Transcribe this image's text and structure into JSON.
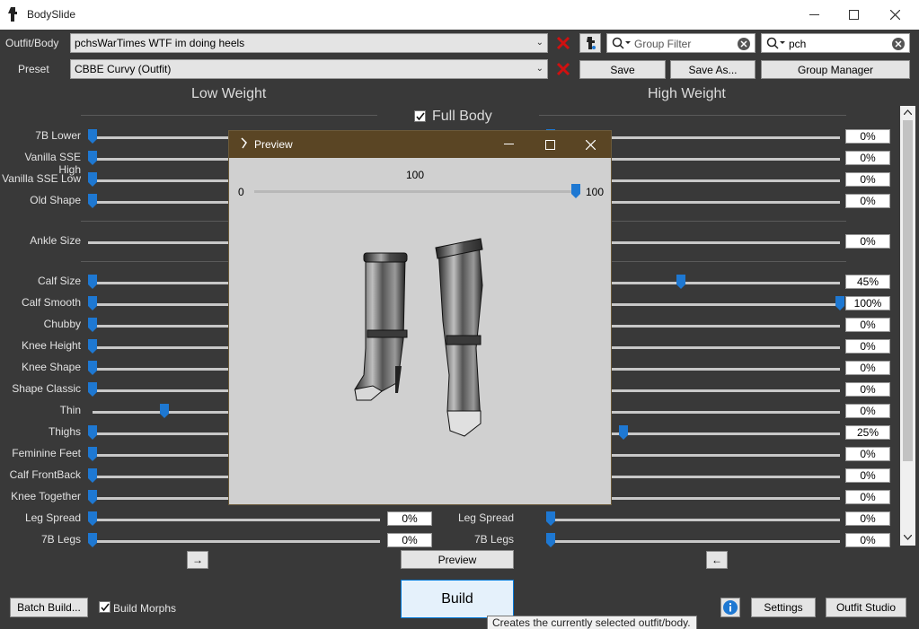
{
  "window": {
    "title": "BodySlide"
  },
  "outfit_row": {
    "label": "Outfit/Body",
    "value": "pchsWarTimes WTF im doing heels",
    "group_filter_placeholder": "Group Filter",
    "outfit_filter_value": "pch"
  },
  "preset_row": {
    "label": "Preset",
    "value": "CBBE Curvy (Outfit)",
    "save_label": "Save",
    "save_as_label": "Save As...",
    "group_manager_label": "Group Manager"
  },
  "headers": {
    "low_weight": "Low Weight",
    "high_weight": "High Weight",
    "full_body": "Full Body",
    "full_body_checked": true
  },
  "sliders": [
    {
      "name": "7B Lower",
      "low": 0,
      "high": 0,
      "high_value": "0%"
    },
    {
      "name": "Vanilla SSE High",
      "low": 0,
      "high": 0,
      "high_value": "0%"
    },
    {
      "name": "Vanilla SSE Low",
      "low": 0,
      "high": 0,
      "high_value": "0%"
    },
    {
      "name": "Old Shape",
      "low": 0,
      "high": 0,
      "high_value": "0%"
    },
    {
      "name": "Ankle Size",
      "low": 0,
      "high": 0,
      "high_value": "0%"
    },
    {
      "name": "Calf Size",
      "low": 0,
      "high": 45,
      "high_value": "45%"
    },
    {
      "name": "Calf Smooth",
      "low": 0,
      "high": 100,
      "high_value": "100%"
    },
    {
      "name": "Chubby",
      "low": 0,
      "high": 0,
      "high_value": "0%"
    },
    {
      "name": "Knee Height",
      "low": 0,
      "high": 0,
      "high_value": "0%"
    },
    {
      "name": "Knee Shape",
      "low": 0,
      "high": 0,
      "high_value": "0%"
    },
    {
      "name": "Shape Classic",
      "low": 0,
      "high": 0,
      "high_value": "0%"
    },
    {
      "name": "Thin",
      "low": 25,
      "high": 0,
      "high_value": "0%"
    },
    {
      "name": "Thighs",
      "low": 0,
      "high": 25,
      "high_value": "25%"
    },
    {
      "name": "Feminine Feet",
      "low": 0,
      "high": 0,
      "high_value": "0%"
    },
    {
      "name": "Calf FrontBack",
      "low": 0,
      "high": 0,
      "high_value": "0%"
    },
    {
      "name": "Knee Together",
      "low": 0,
      "high": 0,
      "high_value": "0%"
    },
    {
      "name": "Leg Spread",
      "low": 0,
      "high": 0,
      "high_value": "0%",
      "low_value": "0%"
    },
    {
      "name": "7B Legs",
      "low": 0,
      "high": 0,
      "high_value": "0%",
      "low_value": "0%"
    }
  ],
  "bottom": {
    "arrow_right": "→",
    "arrow_left": "←",
    "preview_label": "Preview",
    "build_label": "Build",
    "batch_build_label": "Batch Build...",
    "build_morphs_label": "Build Morphs",
    "build_morphs_checked": true,
    "settings_label": "Settings",
    "outfit_studio_label": "Outfit Studio",
    "tooltip": "Creates the currently selected outfit/body."
  },
  "preview_window": {
    "title": "Preview",
    "weight_value": "100",
    "min_label": "0",
    "max_label": "100",
    "weight_level": 100
  },
  "colors": {
    "background": "#393939",
    "slider_thumb": "#1e78d2",
    "red_x": "#d01010",
    "preview_titlebar": "#5a4524"
  }
}
